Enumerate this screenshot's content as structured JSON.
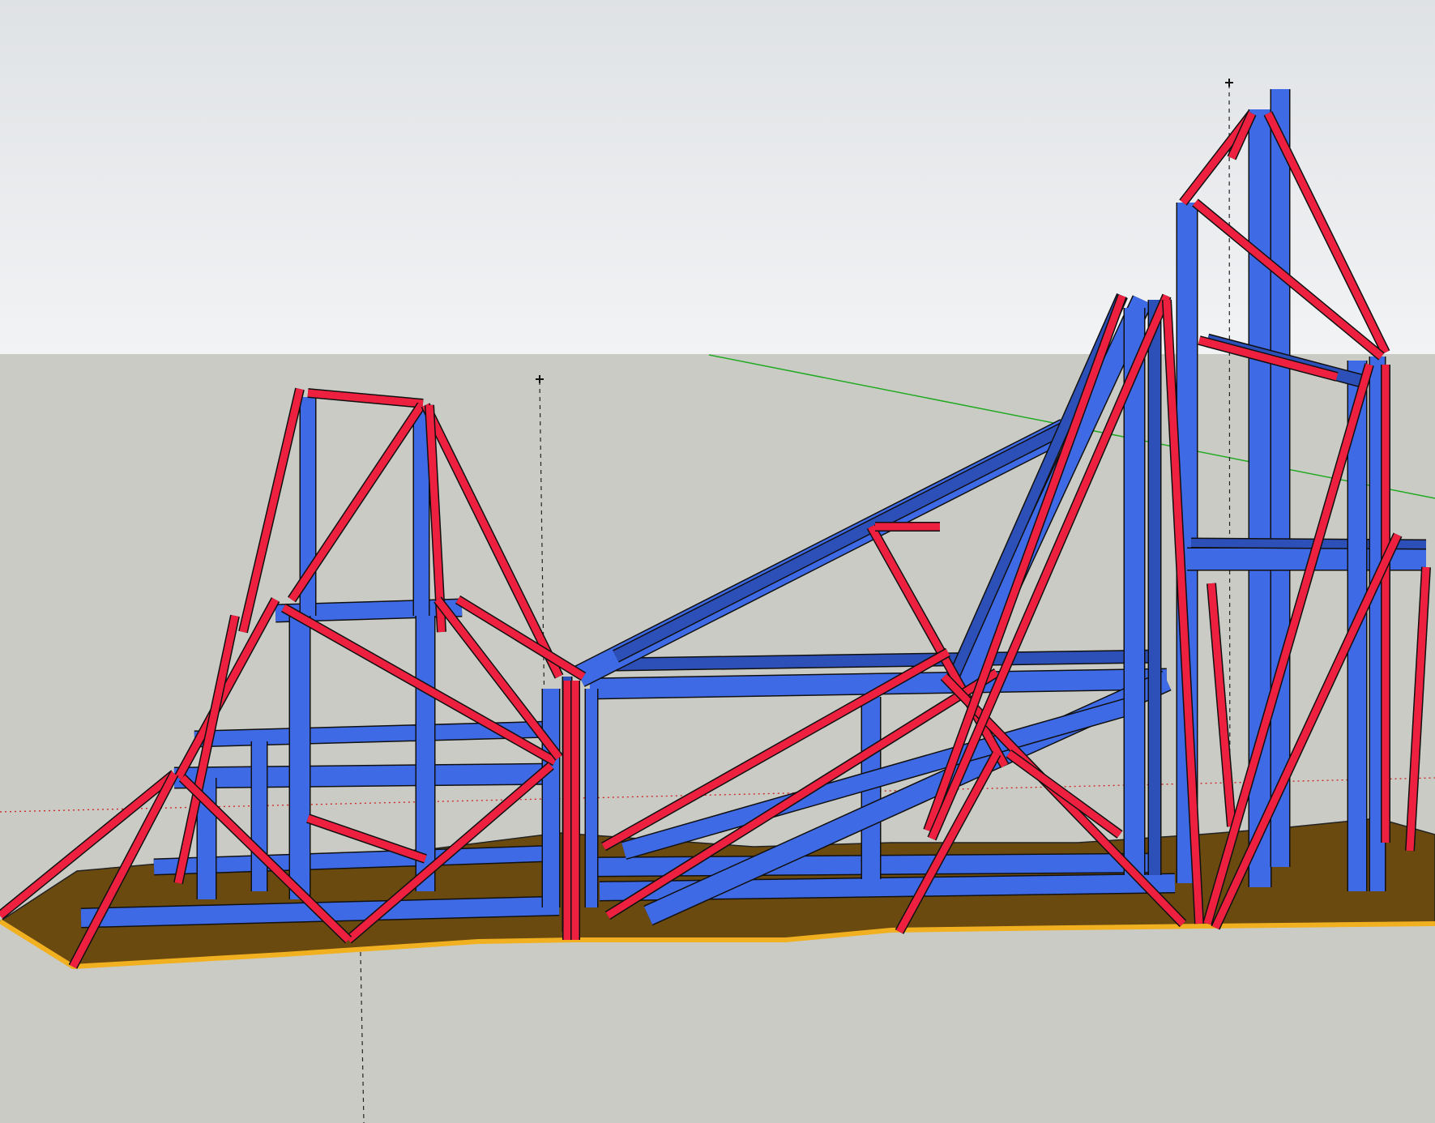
{
  "app": {
    "view": "3d-modeling-viewport",
    "render_style": "shaded-with-edges"
  },
  "colors": {
    "sky_top": "#dfe2e5",
    "sky_bottom": "#f2f3f5",
    "ground": "#cbcbc6",
    "frame_blue": "#3f6ae6",
    "frame_blue_dark": "#2c4fb8",
    "brace_red": "#ee2040",
    "base_brown": "#6b4a10",
    "base_edge": "#f0b020",
    "edge_black": "#101010",
    "axis_green": "#22aa22",
    "axis_red": "#cc2222"
  },
  "scene": {
    "objects": [
      "left-truss-tower",
      "right-truss-tower",
      "inclined-conveyor-beam",
      "brown-base-slab",
      "blue-frame-members",
      "red-cross-bracing"
    ],
    "guide_markers": 3,
    "axes": [
      "green-axis",
      "red-axis"
    ]
  }
}
